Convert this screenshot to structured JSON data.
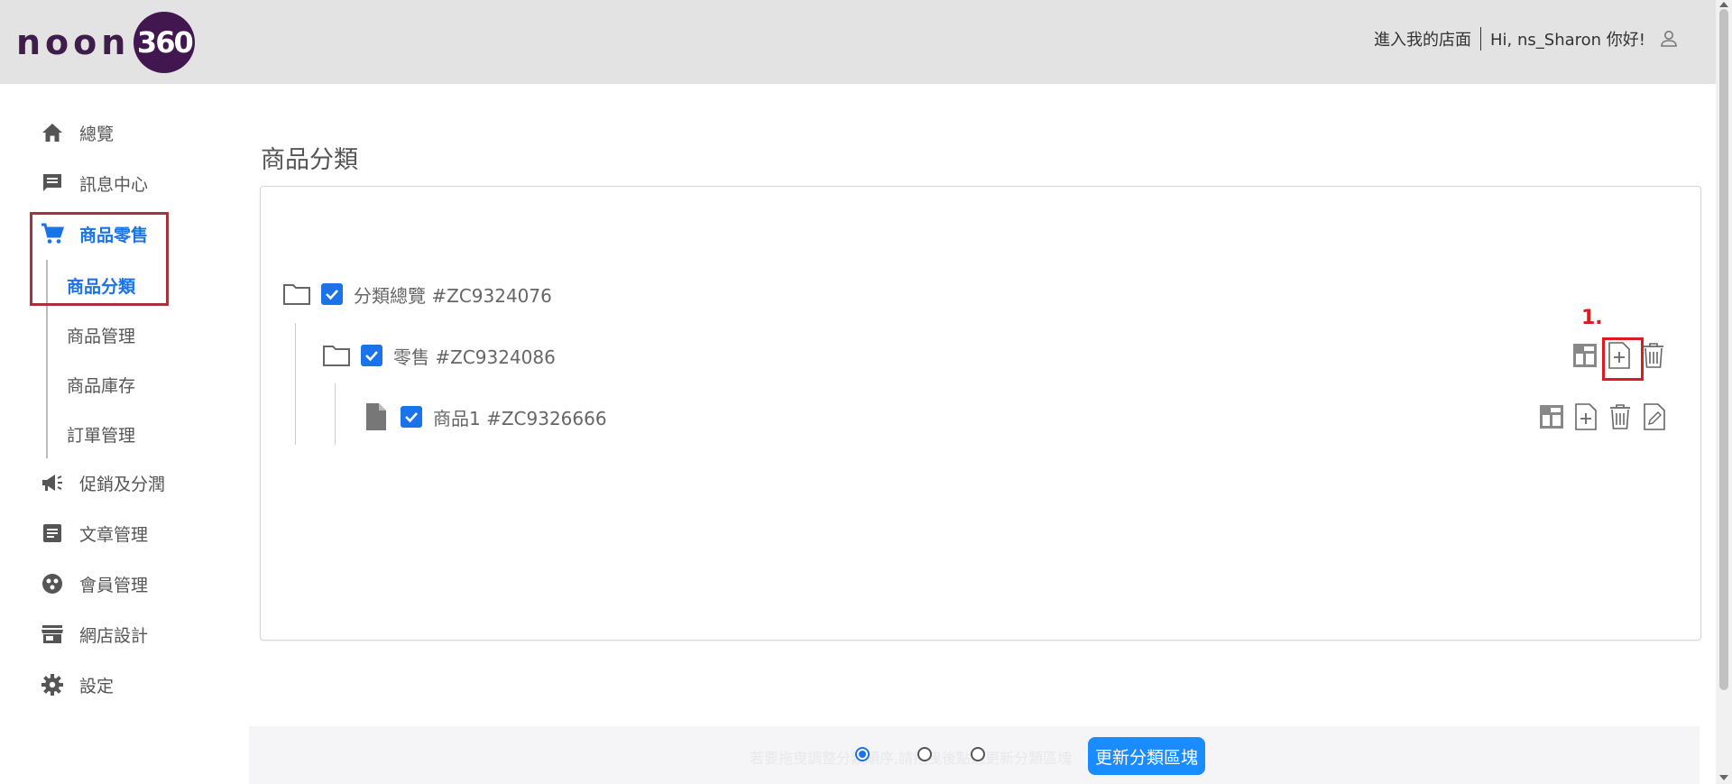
{
  "header": {
    "logo_text": "noon",
    "logo_badge": "360",
    "store_link": "進入我的店面",
    "greeting": "Hi, ns_Sharon 你好!"
  },
  "sidebar": {
    "items": [
      {
        "label": "總覽",
        "icon": "home-icon"
      },
      {
        "label": "訊息中心",
        "icon": "message-icon"
      },
      {
        "label": "商品零售",
        "icon": "cart-icon"
      },
      {
        "label": "促銷及分潤",
        "icon": "megaphone-icon"
      },
      {
        "label": "文章管理",
        "icon": "article-icon"
      },
      {
        "label": "會員管理",
        "icon": "member-icon"
      },
      {
        "label": "網店設計",
        "icon": "store-icon"
      },
      {
        "label": "設定",
        "icon": "gear-icon"
      }
    ],
    "sub_items": [
      "商品分類",
      "商品管理",
      "商品庫存",
      "訂單管理"
    ]
  },
  "main": {
    "title": "商品分類",
    "tree": [
      {
        "label": "分類總覽 #ZC9324076",
        "type": "folder",
        "checked": true
      },
      {
        "label": "零售 #ZC9324086",
        "type": "folder",
        "checked": true
      },
      {
        "label": "商品1 #ZC9326666",
        "type": "file",
        "checked": true
      }
    ],
    "step_label": "1."
  },
  "bottom": {
    "hint": "若要拖曳調整分類順序,請拖曳後點選更新分類區塊",
    "update_button": "更新分類區塊"
  },
  "colors": {
    "accent": "#1a73e8",
    "header_bg": "#e3e3e3",
    "highlight_red": "#e0191f",
    "sidebar_box": "#a3343d",
    "logo_purple": "#42164f"
  }
}
